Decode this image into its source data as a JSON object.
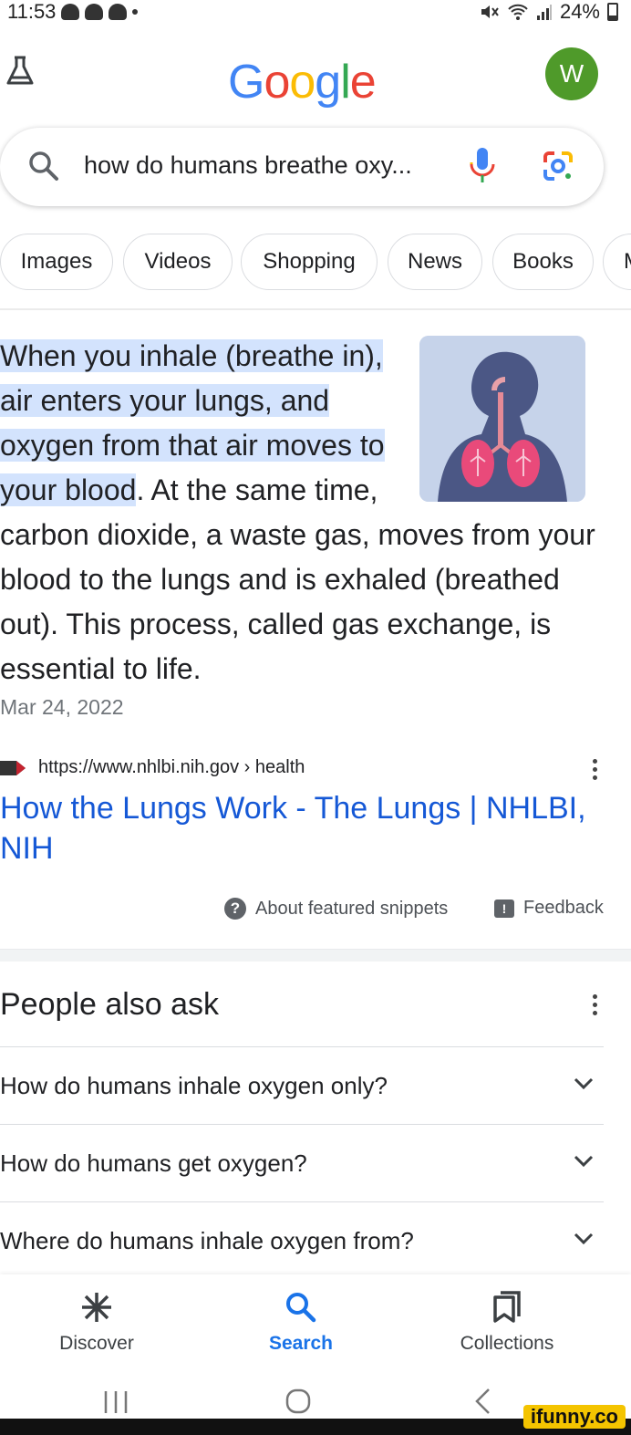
{
  "status_bar": {
    "time": "11:53",
    "battery": "24%"
  },
  "header": {
    "logo_letters": [
      {
        "char": "G",
        "color": "#4285F4"
      },
      {
        "char": "o",
        "color": "#EA4335"
      },
      {
        "char": "o",
        "color": "#FBBC05"
      },
      {
        "char": "g",
        "color": "#4285F4"
      },
      {
        "char": "l",
        "color": "#34A853"
      },
      {
        "char": "e",
        "color": "#EA4335"
      }
    ],
    "avatar_letter": "W"
  },
  "search": {
    "query": "how do humans breathe oxy..."
  },
  "chips": [
    "Images",
    "Videos",
    "Shopping",
    "News",
    "Books",
    "M"
  ],
  "snippet": {
    "highlighted": "When you inhale (breathe in), air enters your lungs, and oxygen from that air moves to your blood",
    "rest": ". At the same time, carbon dioxide, a waste gas, moves from your blood to the lungs and is exhaled (breathed out). This process, called gas exchange, is essential to life.",
    "date": "Mar 24, 2022"
  },
  "result": {
    "url": "https://www.nhlbi.nih.gov › health",
    "title": "How the Lungs Work - The Lungs | NHLBI, NIH"
  },
  "snippet_footer": {
    "about": "About featured snippets",
    "feedback": "Feedback"
  },
  "people_also_ask": {
    "title": "People also ask",
    "questions": [
      "How do humans inhale oxygen only?",
      "How do humans get oxygen?",
      "Where do humans inhale oxygen from?"
    ]
  },
  "bottom_nav": {
    "discover": "Discover",
    "search": "Search",
    "collections": "Collections"
  },
  "watermark": "ifunny.co",
  "colors": {
    "link": "#1558d6",
    "highlight": "#d3e3fd",
    "active_nav": "#1a73e8"
  }
}
